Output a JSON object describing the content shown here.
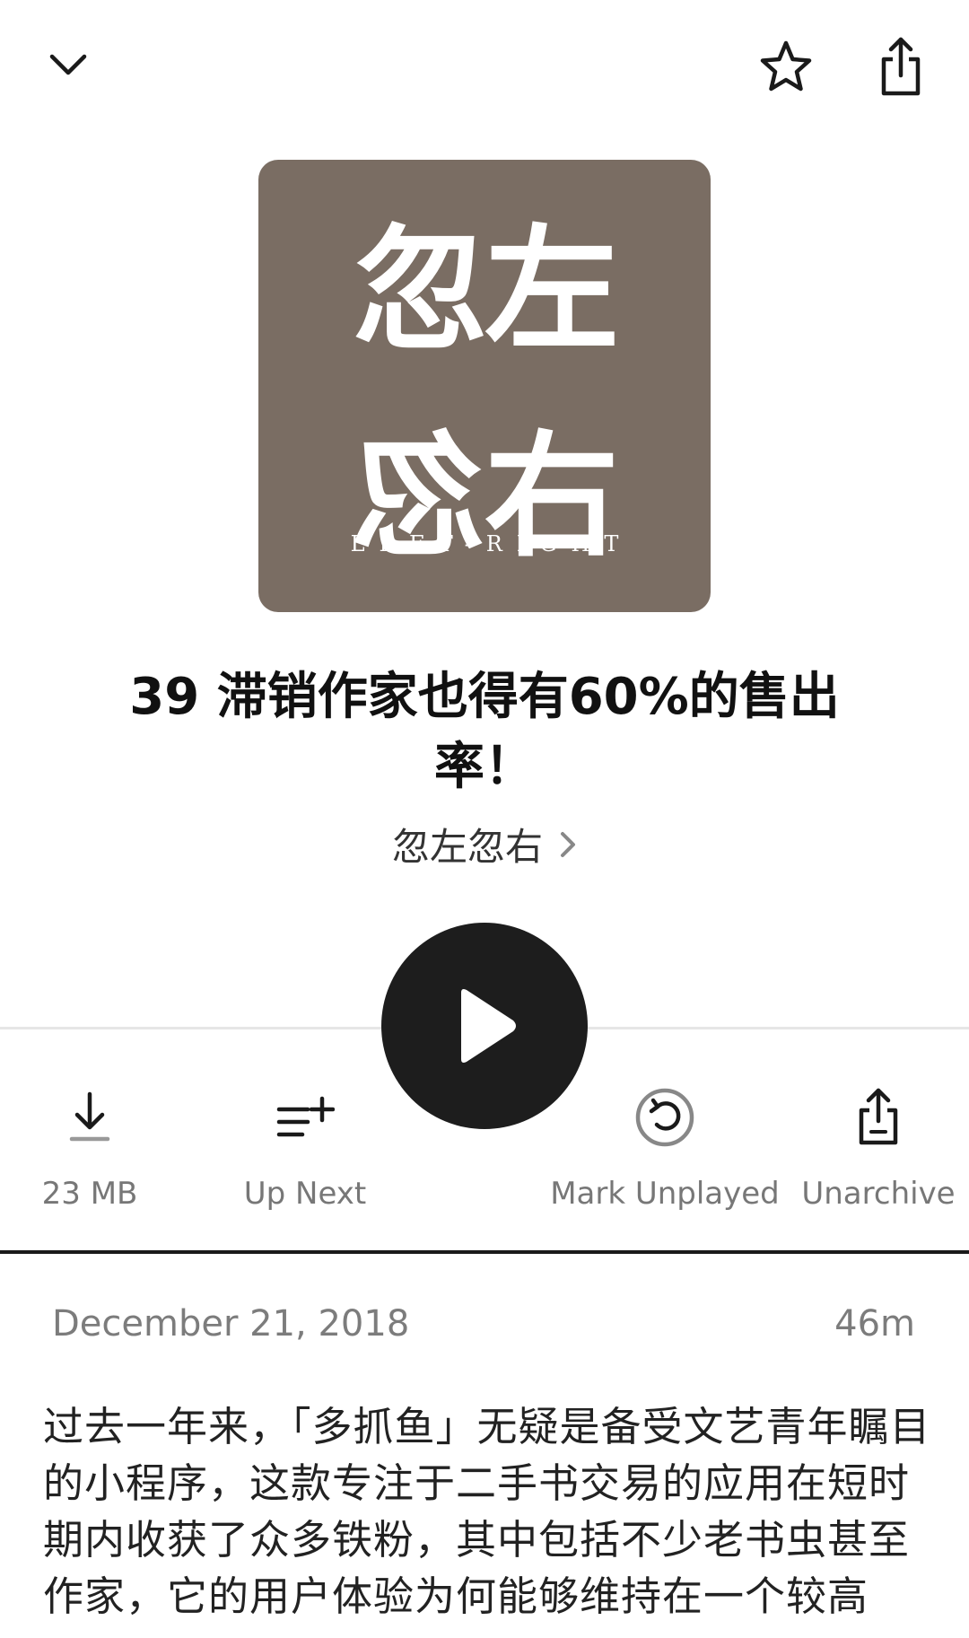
{
  "header": {
    "collapse_icon": "chevron-down-icon",
    "star_icon": "star-icon",
    "share_icon": "share-icon"
  },
  "artwork": {
    "top_text": "忽左",
    "sub_text": "LEFT-RIGHT",
    "bottom_text_left": "忽",
    "bottom_text_right": "右",
    "background_color": "#7a6d63"
  },
  "episode": {
    "title": "39 滞销作家也得有60%的售出率！",
    "podcast_name": "忽左忽右",
    "date": "December 21, 2018",
    "duration": "46m",
    "description": "过去一年来，「多抓鱼」无疑是备受文艺青年瞩目的小程序，这款专注于二手书交易的应用在短时期内收获了众多铁粉，其中包括不少老书虫甚至作家，它的用户体验为何能够维持在一个较高"
  },
  "player": {
    "play_icon": "play-icon"
  },
  "actions": {
    "download_label": "23 MB",
    "up_next_label": "Up Next",
    "mark_unplayed_label": "Mark Unplayed",
    "unarchive_label": "Unarchive"
  }
}
